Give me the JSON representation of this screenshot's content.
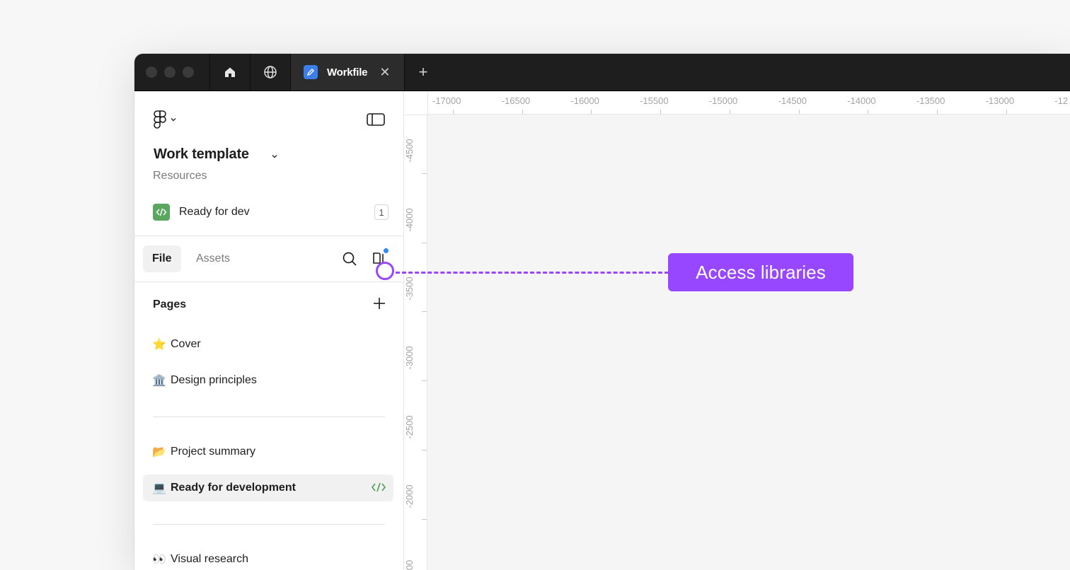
{
  "titlebar": {
    "tab_title": "Workfile",
    "tab_close": "✕",
    "new_tab": "+"
  },
  "panel": {
    "file_name": "Work template",
    "project": "Resources",
    "ready_for_dev": {
      "label": "Ready for dev",
      "count": "1"
    },
    "tabs": {
      "file": "File",
      "assets": "Assets"
    },
    "pages_header": "Pages",
    "pages": [
      {
        "emoji": "⭐️",
        "label": "Cover"
      },
      {
        "emoji": "🏛️",
        "label": "Design principles"
      },
      {
        "emoji": "📂",
        "label": "Project summary"
      },
      {
        "emoji": "💻",
        "label": "Ready for development"
      },
      {
        "emoji": "👀",
        "label": "Visual research"
      }
    ]
  },
  "ruler": {
    "x_labels": [
      "-17000",
      "-16500",
      "-16000",
      "-15500",
      "-15000",
      "-14500",
      "-14000",
      "-13500",
      "-13000",
      "-12"
    ],
    "y_labels": [
      "-4500",
      "-4000",
      "-3500",
      "-3000",
      "-2500",
      "-2000",
      "00"
    ]
  },
  "callout": {
    "label": "Access libraries"
  },
  "colors": {
    "accent": "#9747ff",
    "dev_green": "#5aa860",
    "tab_blue": "#3c7fe8",
    "notification": "#2f8cf4"
  }
}
